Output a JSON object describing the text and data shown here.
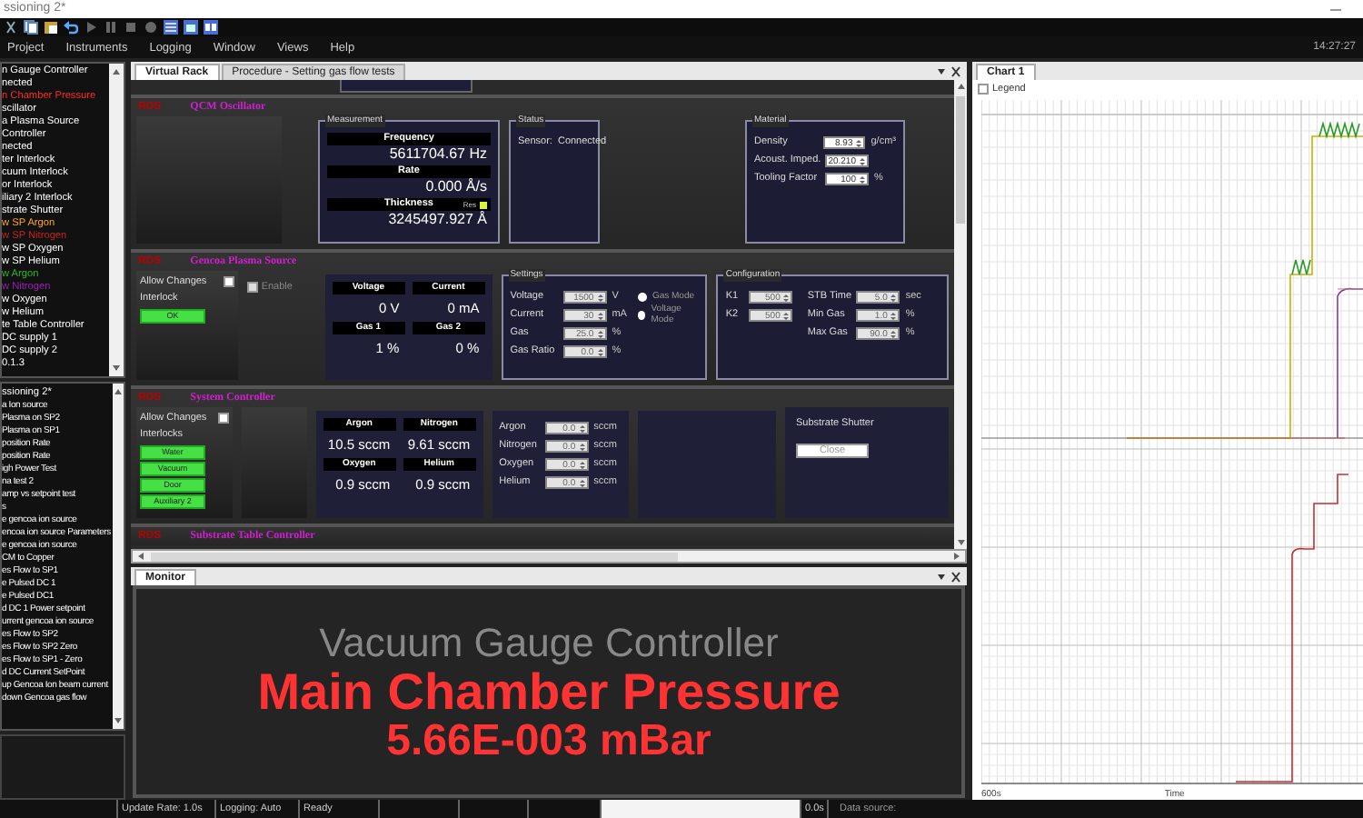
{
  "window": {
    "title": "ssioning 2*"
  },
  "menu": [
    {
      "label": "Project"
    },
    {
      "label": "Instruments"
    },
    {
      "label": "Logging"
    },
    {
      "label": "Window"
    },
    {
      "label": "Views"
    },
    {
      "label": "Help"
    }
  ],
  "clock": "14:27:27",
  "instrument_tree": {
    "items": [
      {
        "label": "n Gauge Controller",
        "color": "#ffffff"
      },
      {
        "label": "nected",
        "color": "#ffffff"
      },
      {
        "label": "n Chamber Pressure",
        "color": "#ff2a2a"
      },
      {
        "label": "scillator",
        "color": "#ffffff"
      },
      {
        "label": "a Plasma Source",
        "color": "#ffffff"
      },
      {
        "label": "Controller",
        "color": "#ffffff"
      },
      {
        "label": "nected",
        "color": "#ffffff"
      },
      {
        "label": "ter Interlock",
        "color": "#ffffff"
      },
      {
        "label": "cuum Interlock",
        "color": "#ffffff"
      },
      {
        "label": "or Interlock",
        "color": "#ffffff"
      },
      {
        "label": "iliary 2 Interlock",
        "color": "#ffffff"
      },
      {
        "label": "strate Shutter",
        "color": "#ffffff"
      },
      {
        "label": "w SP Argon",
        "color": "#ffa526"
      },
      {
        "label": "w SP Nitrogen",
        "color": "#c82020"
      },
      {
        "label": "w SP Oxygen",
        "color": "#ffffff"
      },
      {
        "label": "w SP Helium",
        "color": "#ffffff"
      },
      {
        "label": "w Argon",
        "color": "#2eb82e"
      },
      {
        "label": "w Nitrogen",
        "color": "#9a1fb5"
      },
      {
        "label": "w Oxygen",
        "color": "#ffffff"
      },
      {
        "label": "w Helium",
        "color": "#ffffff"
      },
      {
        "label": "te Table Controller",
        "color": "#ffffff"
      },
      {
        "label": "DC supply 1",
        "color": "#ffffff"
      },
      {
        "label": "DC supply 2",
        "color": "#ffffff"
      },
      {
        "label": "0.1.3",
        "color": "#ffffff"
      }
    ]
  },
  "sequence_list": {
    "title": "ssioning 2*",
    "items": [
      {
        "label": "a Ion source"
      },
      {
        "label": "Plasma on SP2"
      },
      {
        "label": "Plasma on SP1"
      },
      {
        "label": "position Rate"
      },
      {
        "label": "position Rate"
      },
      {
        "label": "igh Power Test"
      },
      {
        "label": "na test 2"
      },
      {
        "label": "amp vs setpoint test"
      },
      {
        "label": "s"
      },
      {
        "label": "e gencoa ion source"
      },
      {
        "label": "encoa ion source Parameters"
      },
      {
        "label": "e gencoa ion source"
      },
      {
        "label": "CM to Copper"
      },
      {
        "label": "es Flow to SP1"
      },
      {
        "label": "e Pulsed DC 1"
      },
      {
        "label": "e Pulsed DC1"
      },
      {
        "label": "d DC 1 Power setpoint"
      },
      {
        "label": "urrent gencoa ion source"
      },
      {
        "label": "es Flow to SP2"
      },
      {
        "label": "es Flow to SP2 Zero"
      },
      {
        "label": "es Flow to SP1 - Zero"
      },
      {
        "label": "d DC Current SetPoint"
      },
      {
        "label": "up Gencoa Ion beam current"
      },
      {
        "label": "down Gencoa gas flow"
      }
    ]
  },
  "document_tabs": [
    {
      "label": "Virtual Rack",
      "selected": true
    },
    {
      "label": "Procedure - Setting gas flow tests",
      "selected": false
    }
  ],
  "rack": [
    {
      "kind": "qcm",
      "tag": "RDS",
      "title": "QCM Oscillator",
      "measurement": {
        "title": "Measurement",
        "rows": [
          {
            "label": "Frequency",
            "value": "5611704.67 Hz"
          },
          {
            "label": "Rate",
            "value": "0.000 Å/s"
          },
          {
            "label": "Thickness",
            "value": "3245497.927 Å",
            "flag": "Res",
            "on": true
          }
        ]
      },
      "status": {
        "title": "Status",
        "label": "Sensor:",
        "value": "Connected"
      },
      "material": {
        "title": "Material",
        "fields": [
          {
            "label": "Density",
            "value": "8.93",
            "unit": "g/cm³"
          },
          {
            "label": "Acoust. Imped.",
            "value": "20.210"
          },
          {
            "label": "Tooling Factor",
            "value": "100",
            "unit": "%"
          }
        ]
      }
    },
    {
      "kind": "plasma",
      "tag": "RDS",
      "title": "Gencoa Plasma Source",
      "allow": {
        "label": "Allow Changes",
        "checked": false
      },
      "interlock": {
        "label": "Interlock",
        "lights": [
          {
            "label": "OK",
            "on": true
          }
        ]
      },
      "enable": {
        "label": "Enable",
        "checked": false,
        "disabled": true
      },
      "readouts": [
        {
          "label": "Voltage",
          "value": "0 V"
        },
        {
          "label": "Current",
          "value": "0 mA"
        },
        {
          "label": "Gas 1",
          "value": "1 %"
        },
        {
          "label": "Gas 2",
          "value": "0 %"
        }
      ],
      "settings": {
        "title": "Settings",
        "fields": [
          {
            "label": "Voltage",
            "value": "1500",
            "unit": "V"
          },
          {
            "label": "Current",
            "value": "30",
            "unit": "mA"
          },
          {
            "label": "Gas",
            "value": "25.0",
            "unit": "%"
          },
          {
            "label": "Gas Ratio",
            "value": "0.0",
            "unit": "%"
          }
        ],
        "modes": [
          {
            "label": "Gas Mode",
            "selected": false
          },
          {
            "label": "Voltage Mode",
            "selected": false
          }
        ]
      },
      "configuration": {
        "title": "Configuration",
        "fields": [
          {
            "label": "K1",
            "value": "500"
          },
          {
            "label": "K2",
            "value": "500"
          }
        ],
        "limits": [
          {
            "label": "STB Time",
            "value": "5.0",
            "unit": "sec"
          },
          {
            "label": "Min Gas",
            "value": "1.0",
            "unit": "%"
          },
          {
            "label": "Max Gas",
            "value": "90.0",
            "unit": "%"
          }
        ]
      }
    },
    {
      "kind": "system",
      "tag": "RDS",
      "title": "System Controller",
      "allow": {
        "label": "Allow Changes",
        "checked": false
      },
      "interlock": {
        "label": "Interlocks",
        "lights": [
          {
            "label": "Water",
            "on": true
          },
          {
            "label": "Vacuum",
            "on": true
          },
          {
            "label": "Door",
            "on": true
          },
          {
            "label": "Auxiliary 2",
            "on": true
          }
        ]
      },
      "readouts": [
        {
          "label": "Argon",
          "value": "10.5 sccm"
        },
        {
          "label": "Nitrogen",
          "value": "9.61 sccm"
        },
        {
          "label": "Oxygen",
          "value": "0.9 sccm"
        },
        {
          "label": "Helium",
          "value": "0.9 sccm"
        }
      ],
      "setpoints": [
        {
          "label": "Argon",
          "value": "0.0",
          "unit": "sccm"
        },
        {
          "label": "Nitrogen",
          "value": "0.0",
          "unit": "sccm"
        },
        {
          "label": "Oxygen",
          "value": "0.0",
          "unit": "sccm"
        },
        {
          "label": "Helium",
          "value": "0.0",
          "unit": "sccm"
        }
      ],
      "shutter": {
        "label": "Substrate Shutter",
        "button": "Close"
      }
    },
    {
      "kind": "substrate",
      "tag": "RDS",
      "title": "Substrate Table Controller"
    }
  ],
  "monitor": {
    "tab": "Monitor",
    "instrument": "Vacuum Gauge Controller",
    "channel": "Main Chamber Pressure",
    "reading": "5.66E-003 mBar"
  },
  "chart_panel": {
    "tab": "Chart 1",
    "legend": {
      "label": "Legend",
      "checked": false
    },
    "x_start": "600s",
    "x_label": "Time"
  },
  "status_bar": [
    {
      "kind": "empty"
    },
    {
      "kind": "text",
      "text": "Update Rate: 1.0s"
    },
    {
      "kind": "text",
      "text": "Logging: Auto"
    },
    {
      "kind": "text",
      "text": "Ready"
    },
    {
      "kind": "empty"
    },
    {
      "kind": "empty"
    },
    {
      "kind": "empty"
    },
    {
      "kind": "blank"
    },
    {
      "kind": "text",
      "text": "0.0s"
    }
  ],
  "data_source": "Data source:"
}
